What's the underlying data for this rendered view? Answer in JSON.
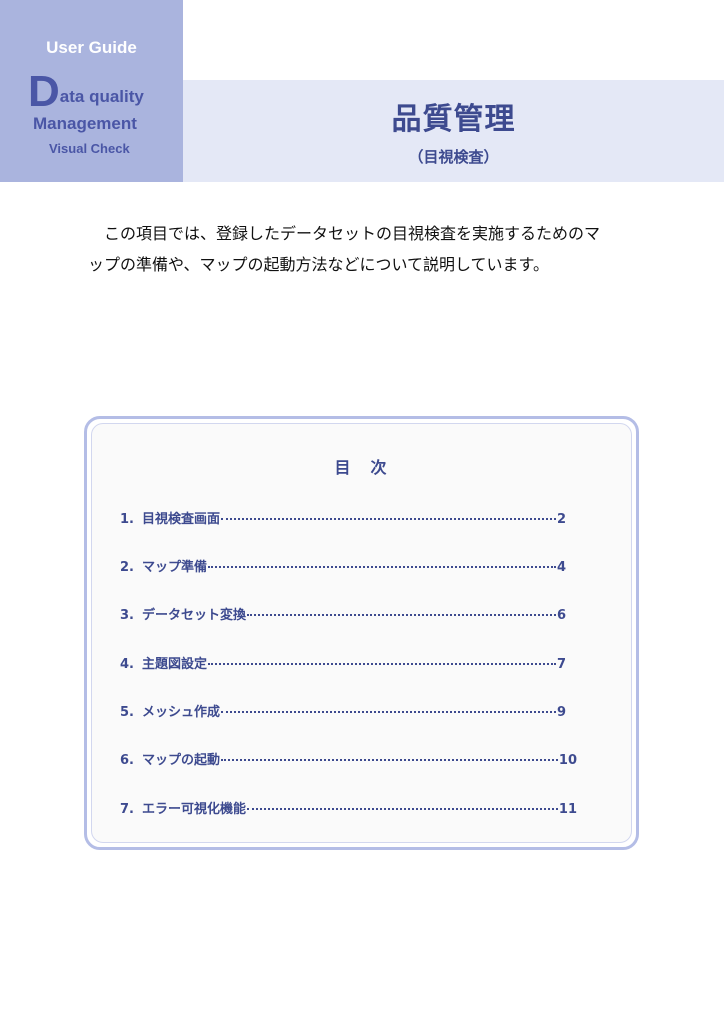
{
  "header": {
    "user_guide": "User Guide",
    "logo_initial": "D",
    "logo_line1": "ata quality",
    "logo_line2": "Management",
    "logo_line3": "Visual Check",
    "title": "品質管理",
    "subtitle": "（目視検査）"
  },
  "intro": {
    "line1": "この項目では、登録したデータセットの目視検査を実施するためのマ",
    "line2": "ップの準備や、マップの起動方法などについて説明しています。"
  },
  "toc": {
    "heading": "目　次",
    "items": [
      {
        "num": "1.",
        "label": "目視検査画面",
        "page": "2"
      },
      {
        "num": "2.",
        "label": "マップ準備",
        "page": "4"
      },
      {
        "num": "3.",
        "label": "データセット変換",
        "page": "6"
      },
      {
        "num": "4.",
        "label": "主題図設定",
        "page": "7"
      },
      {
        "num": "5.",
        "label": "メッシュ作成",
        "page": "9"
      },
      {
        "num": "6.",
        "label": "マップの起動",
        "page": "10"
      },
      {
        "num": "7.",
        "label": " エラー可視化機能",
        "page": "11"
      }
    ]
  },
  "colors": {
    "accent": "#3d4a8f",
    "side_block": "#aab4de",
    "title_band": "#e4e8f6",
    "toc_border": "#b4bde6"
  }
}
